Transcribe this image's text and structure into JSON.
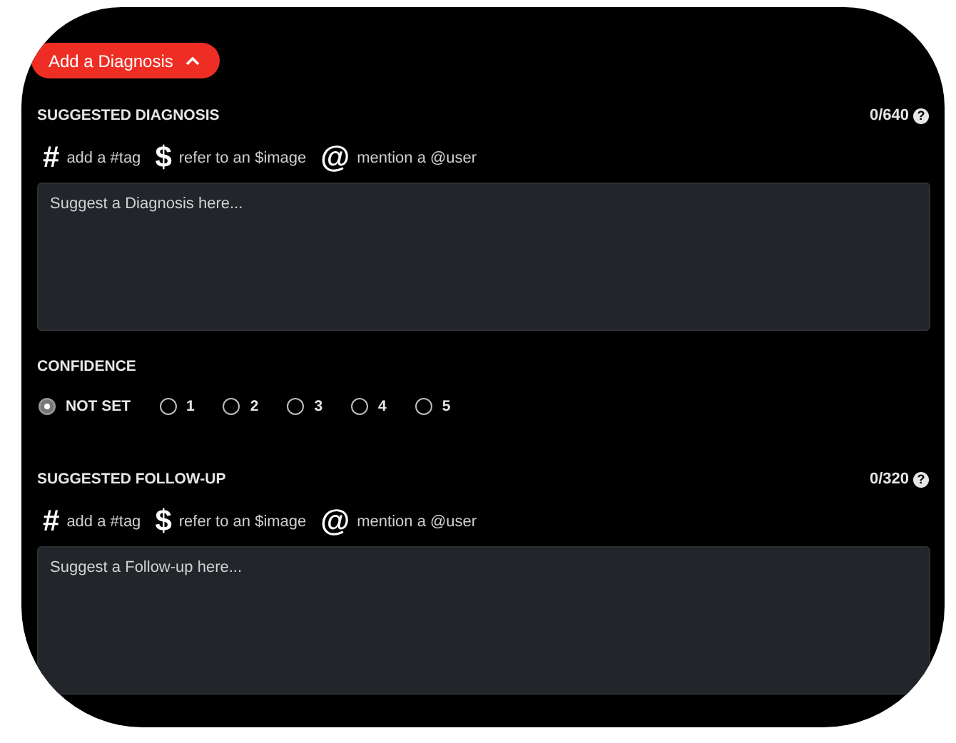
{
  "add_button": {
    "label": "Add a Diagnosis",
    "expanded": true
  },
  "sections": [
    {
      "kind": "text",
      "title": "SUGGESTED DIAGNOSIS",
      "counter": "0/640",
      "help": "?",
      "placeholder": "Suggest a Diagnosis here...",
      "tools": [
        {
          "symbol": "#",
          "label": "add a #tag"
        },
        {
          "symbol": "$",
          "label": "refer to an $image"
        },
        {
          "symbol": "@",
          "label": "mention a @user"
        }
      ]
    },
    {
      "kind": "radio",
      "title": "CONFIDENCE",
      "options": [
        {
          "label": "NOT SET",
          "selected": true
        },
        {
          "label": "1",
          "selected": false
        },
        {
          "label": "2",
          "selected": false
        },
        {
          "label": "3",
          "selected": false
        },
        {
          "label": "4",
          "selected": false
        },
        {
          "label": "5",
          "selected": false
        }
      ]
    },
    {
      "kind": "text",
      "title": "SUGGESTED FOLLOW-UP",
      "counter": "0/320",
      "help": "?",
      "placeholder": "Suggest a Follow-up here...",
      "tools": [
        {
          "symbol": "#",
          "label": "add a #tag"
        },
        {
          "symbol": "$",
          "label": "refer to an $image"
        },
        {
          "symbol": "@",
          "label": "mention a @user"
        }
      ]
    }
  ]
}
